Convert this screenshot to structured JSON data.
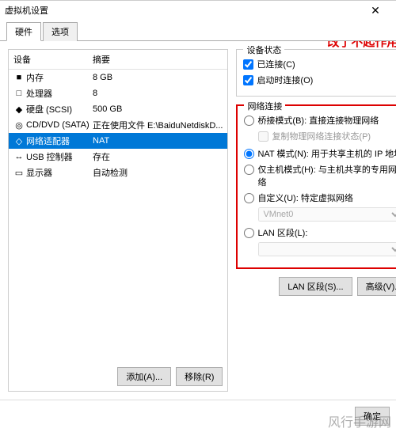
{
  "window": {
    "title": "虚拟机设置"
  },
  "tabs": {
    "hardware": "硬件",
    "options": "选项"
  },
  "columns": {
    "device": "设备",
    "summary": "摘要"
  },
  "devices": [
    {
      "icon": "■",
      "name": "内存",
      "summary": "8 GB"
    },
    {
      "icon": "□",
      "name": "处理器",
      "summary": "8"
    },
    {
      "icon": "◆",
      "name": "硬盘 (SCSI)",
      "summary": "500 GB"
    },
    {
      "icon": "◎",
      "name": "CD/DVD (SATA)",
      "summary": "正在使用文件 E:\\BaiduNetdiskD..."
    },
    {
      "icon": "◇",
      "name": "网络适配器",
      "summary": "NAT"
    },
    {
      "icon": "↔",
      "name": "USB 控制器",
      "summary": "存在"
    },
    {
      "icon": "▭",
      "name": "显示器",
      "summary": "自动检测"
    }
  ],
  "buttons": {
    "add": "添加(A)...",
    "remove": "移除(R)",
    "ok": "确定",
    "lanSegments": "LAN 区段(S)...",
    "advanced": "高级(V)..."
  },
  "status": {
    "groupTitle": "设备状态",
    "connected": "已连接(C)",
    "connectAtPowerOn": "启动时连接(O)"
  },
  "annotation": "改了不起作用？",
  "net": {
    "groupTitle": "网络连接",
    "bridged": "桥接模式(B): 直接连接物理网络",
    "replicate": "复制物理网络连接状态(P)",
    "nat": "NAT 模式(N): 用于共享主机的 IP 地址",
    "hostOnly": "仅主机模式(H): 与主机共享的专用网络",
    "custom": "自定义(U): 特定虚拟网络",
    "customValue": "VMnet0",
    "lan": "LAN 区段(L):",
    "lanValue": ""
  },
  "watermark": "风行手游网"
}
